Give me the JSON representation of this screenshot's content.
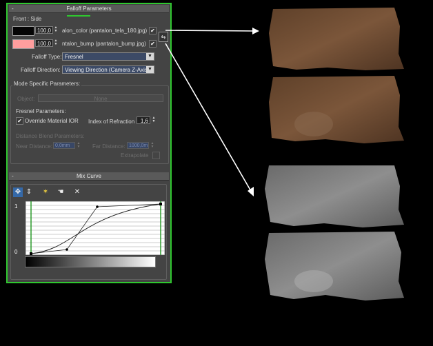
{
  "falloff": {
    "title": "Falloff Parameters",
    "collapse": "-",
    "front_side_label": "Front : Side",
    "front": {
      "value": "100,0",
      "map": "alon_color (pantalon_tela_180.jpg)",
      "color": "#050505",
      "enabled": "✔"
    },
    "side": {
      "value": "100,0",
      "map": "ntalon_bump (pantalon_bump.jpg)",
      "color": "#ff9e9e",
      "enabled": "✔"
    },
    "falloff_type_label": "Falloff Type:",
    "falloff_type_value": "Fresnel",
    "falloff_direction_label": "Falloff Direction:",
    "falloff_direction_value": "Viewing Direction (Camera Z-Axis)",
    "mode_specific_label": "Mode Specific Parameters:",
    "object_label": "Object:",
    "object_value": "None",
    "fresnel_label": "Fresnel Parameters:",
    "override_ior_check": "✔",
    "override_ior_label": "Override Material IOR",
    "ior_label": "Index of Refraction",
    "ior_value": "1,6",
    "distance_blend_label": "Distance Blend Parameters:",
    "near_distance_label": "Near Distance:",
    "near_distance_value": "0,0mm",
    "far_distance_label": "Far Distance:",
    "far_distance_value": "1000,0m",
    "extrapolate_label": "Extrapolate"
  },
  "mix_curve": {
    "title": "Mix Curve",
    "collapse": "-",
    "toolbar": [
      "✥",
      "⇕",
      "✶",
      "☚",
      "✕"
    ],
    "y_top": "1",
    "y_bottom": "0"
  },
  "preview": {
    "colors": {
      "fabric_brown": "#6b4a30",
      "fabric_gray": "#7a7a7a",
      "arrow": "#ffffff",
      "panel_border": "#2fc82f"
    }
  }
}
